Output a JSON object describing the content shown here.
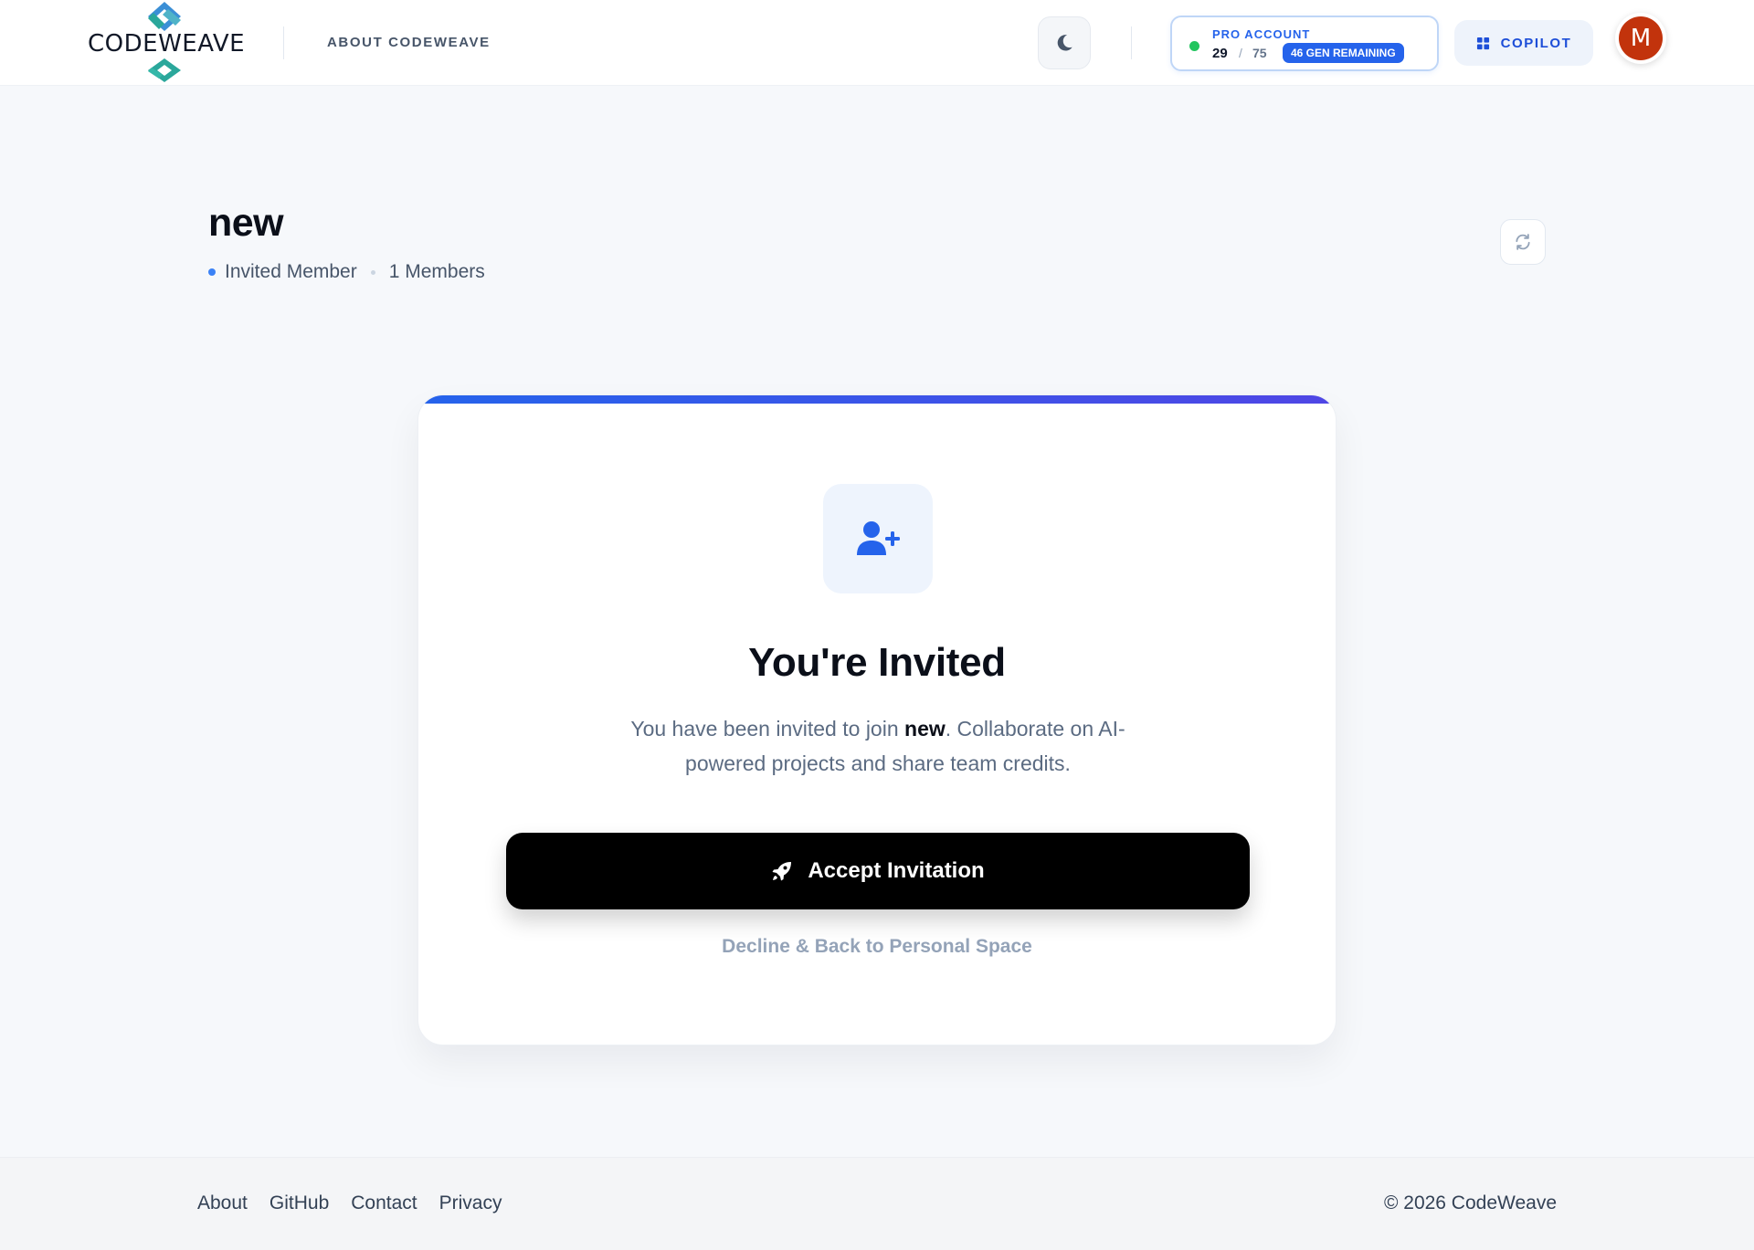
{
  "header": {
    "brand": "CODEWEAVE",
    "nav_about": "ABOUT CODEWEAVE",
    "theme_icon": "moon-icon",
    "account": {
      "label": "PRO ACCOUNT",
      "used": "29",
      "separator": "/",
      "total": "75",
      "remaining_badge": "46 GEN REMAINING",
      "status_color": "#22c55e"
    },
    "copilot_label": "COPILOT",
    "copilot_icon": "grid-icon",
    "avatar_initial": "M",
    "avatar_color": "#c2330c"
  },
  "page": {
    "title": "new",
    "role": "Invited Member",
    "members": "1 Members",
    "refresh_icon": "refresh-icon"
  },
  "invite": {
    "icon": "user-plus-icon",
    "title": "You're Invited",
    "desc_before": "You have been invited to join ",
    "desc_team": "new",
    "desc_after": ". Collaborate on AI-powered projects and share team credits.",
    "accept_label": "Accept Invitation",
    "accept_icon": "rocket-icon",
    "decline_label": "Decline & Back to Personal Space",
    "accent_gradient": [
      "#2563eb",
      "#4f46e5"
    ]
  },
  "footer": {
    "links": [
      "About",
      "GitHub",
      "Contact",
      "Privacy"
    ],
    "copyright": "© 2026 CodeWeave"
  }
}
